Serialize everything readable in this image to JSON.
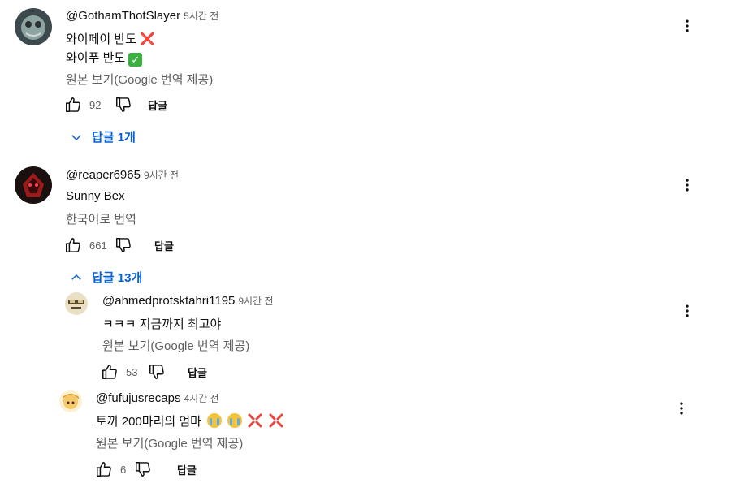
{
  "comments": [
    {
      "author": "@GothamThotSlayer",
      "time": "5시간 전",
      "line1": "와이페이 반도",
      "line1_emoji": "❌",
      "line2": "와이푸 반도",
      "line2_emoji": "✓",
      "translate": "원본 보기(Google 번역 제공)",
      "likes": "92",
      "reply_label": "답글",
      "replies_toggle": "답글 1개"
    },
    {
      "author": "@reaper6965",
      "time": "9시간 전",
      "line1": "Sunny Bex",
      "translate": "한국어로 번역",
      "likes": "661",
      "reply_label": "답글",
      "replies_toggle": "답글 13개"
    }
  ],
  "replies": [
    {
      "author": "@ahmedprotsktahri1195",
      "time": "9시간 전",
      "line1": "ㅋㅋㅋ 지금까지 최고야",
      "translate": "원본 보기(Google 번역 제공)",
      "likes": "53",
      "reply_label": "답글"
    },
    {
      "author": "@fufujusrecaps",
      "time": "4시간 전",
      "line1": "토끼 200마리의 엄마",
      "translate": "원본 보기(Google 번역 제공)",
      "likes": "6",
      "reply_label": "답글"
    }
  ],
  "colors": {
    "link_blue": "#065fd4",
    "secondary_text": "#606060",
    "primary_text": "#0f0f0f"
  },
  "icons": [
    "like-icon",
    "dislike-icon",
    "more-vert-icon",
    "chevron-down-icon",
    "chevron-up-icon"
  ]
}
